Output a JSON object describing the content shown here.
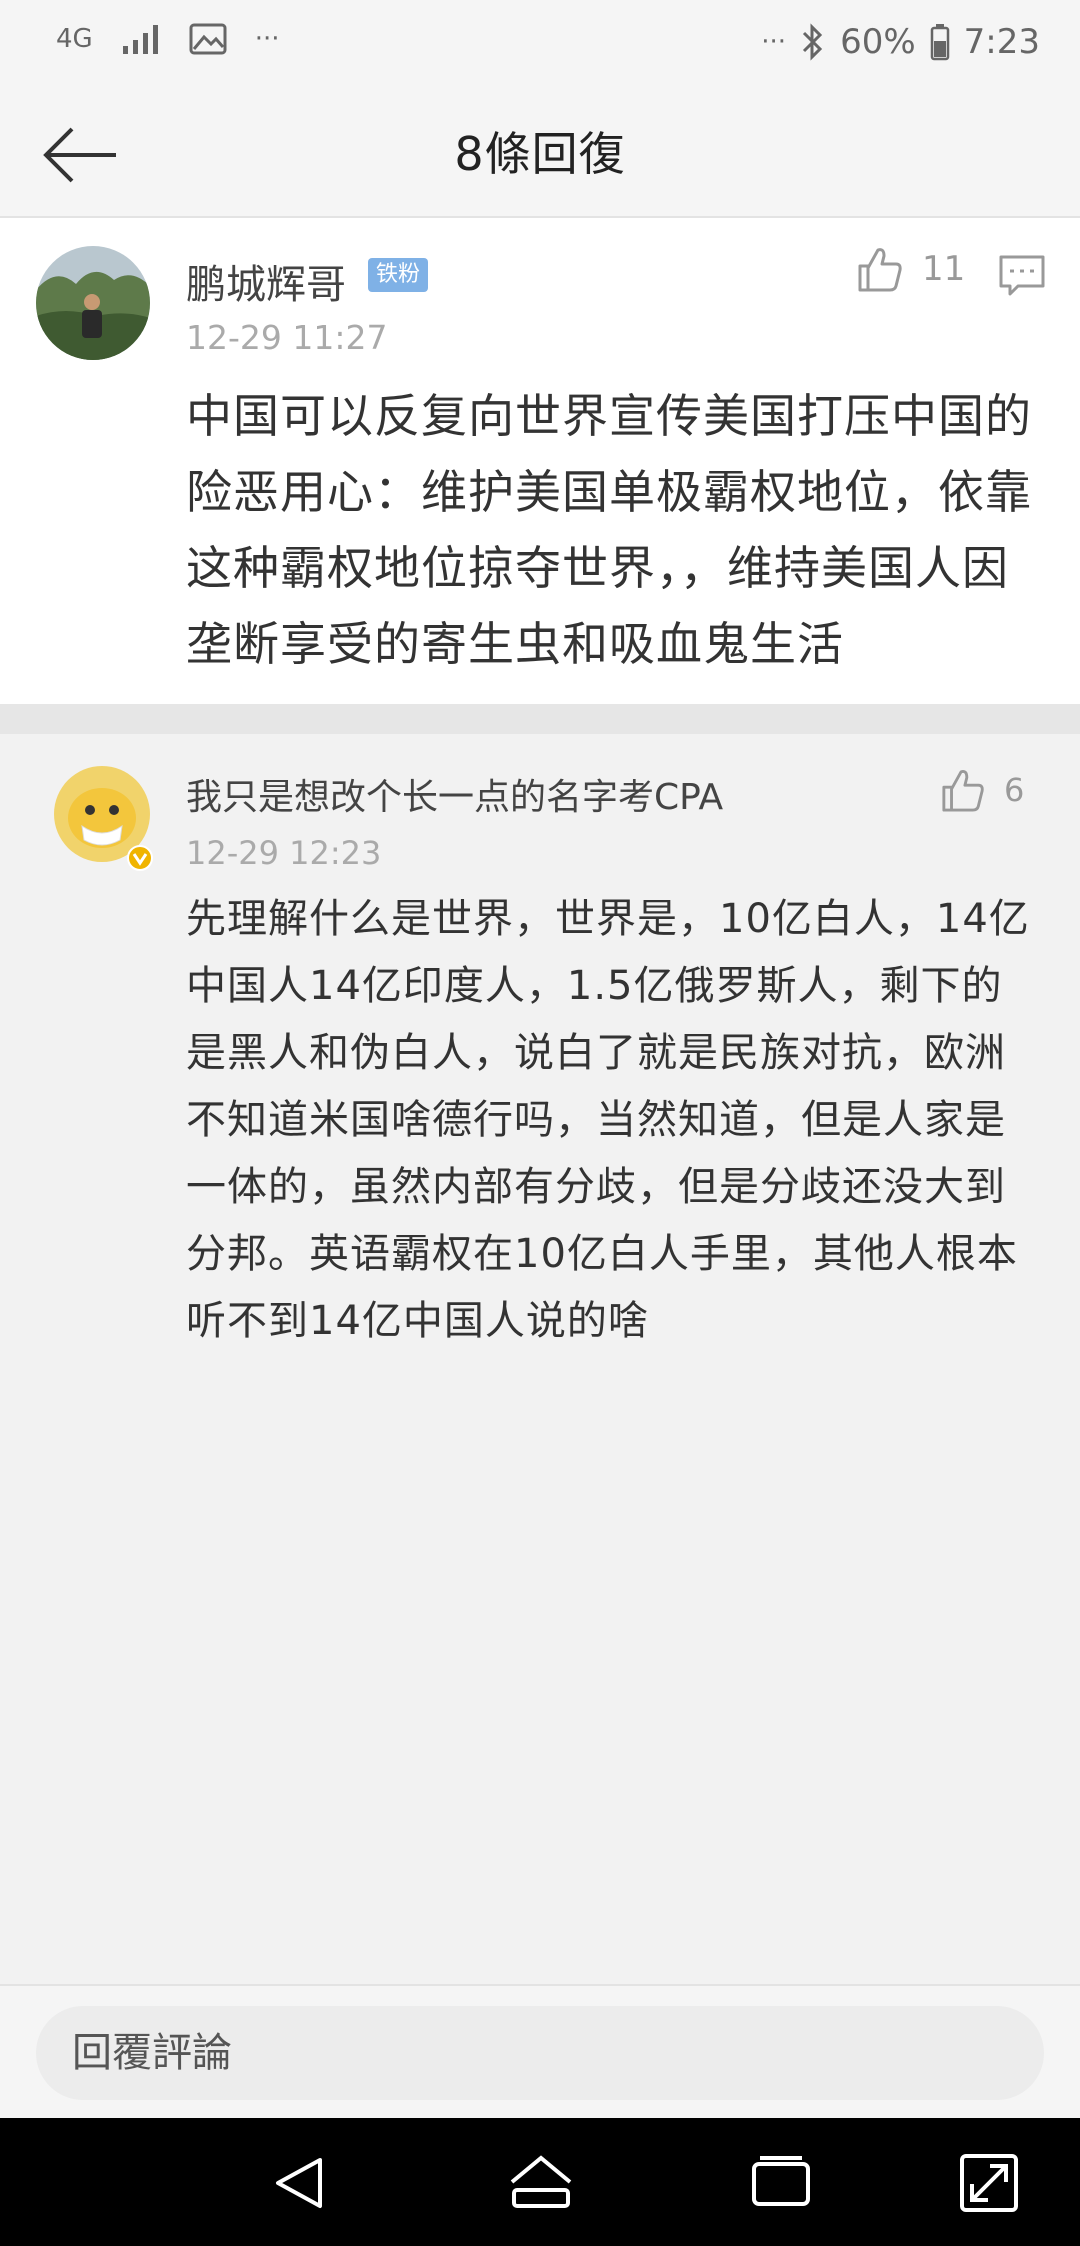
{
  "status_bar": {
    "network": "4G",
    "more_left": "···",
    "more_right": "···",
    "battery": "60%",
    "time": "7:23"
  },
  "header": {
    "title": "8條回復"
  },
  "comments": [
    {
      "username": "鹏城辉哥",
      "badge": "铁粉",
      "time": "12-29 11:27",
      "likes": "11",
      "text": "中国可以反复向世界宣传美国打压中国的险恶用心：维护美国单极霸权地位，依靠这种霸权地位掠夺世界，，维持美国人因垄断享受的寄生虫和吸血鬼生活"
    },
    {
      "username": "我只是想改个长一点的名字考CPA",
      "time": "12-29 12:23",
      "likes": "6",
      "text": "先理解什么是世界，世界是，10亿白人，14亿中国人14亿印度人，1.5亿俄罗斯人，剩下的是黑人和伪白人，说白了就是民族对抗，欧洲不知道米国啥德行吗，当然知道，但是人家是一体的，虽然内部有分歧，但是分歧还没大到分邦。英语霸权在10亿白人手里，其他人根本听不到14亿中国人说的啥"
    }
  ],
  "reply_bar": {
    "placeholder": "回覆評論"
  },
  "icons": {
    "back": "arrow-left-icon",
    "like": "thumbs-up-icon",
    "reply": "comment-bubble-icon",
    "verified": "verified-badge-icon",
    "nav_back": "nav-back-icon",
    "nav_home": "nav-home-icon",
    "nav_recents": "nav-recents-icon",
    "nav_expand": "nav-expand-icon"
  },
  "colors": {
    "badge_blue": "#7fb1e6",
    "verified_gold": "#f0b400",
    "background": "#f2f2f2"
  }
}
